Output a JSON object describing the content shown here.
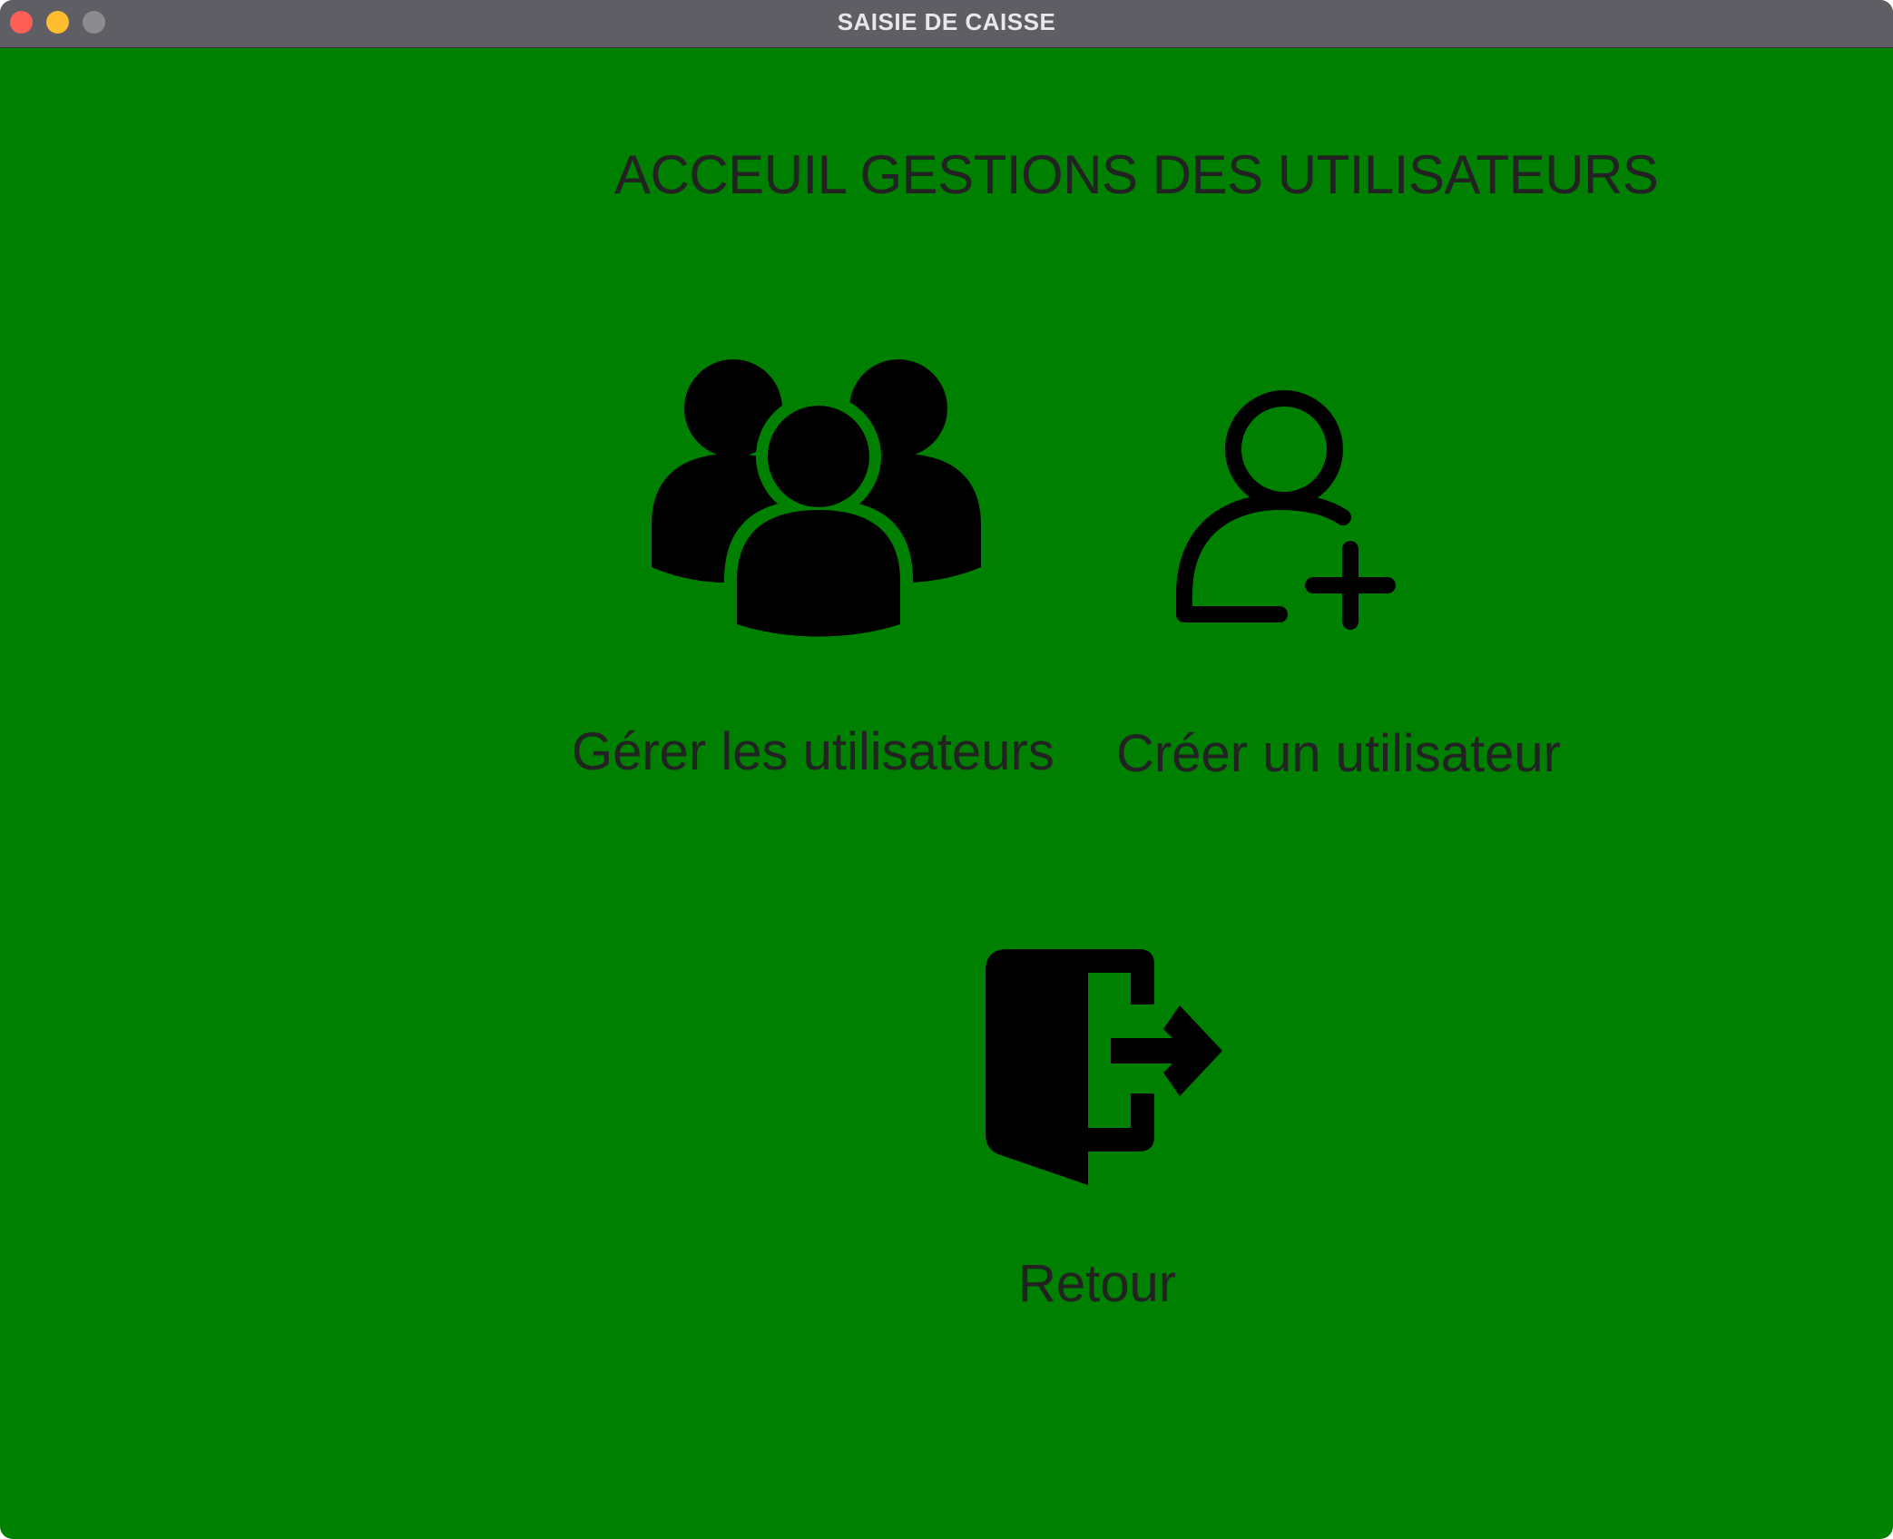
{
  "window": {
    "title": "SAISIE DE CAISSE"
  },
  "main": {
    "heading": "ACCEUIL GESTIONS DES UTILISATEURS",
    "actions": [
      {
        "label": "Gérer les utilisateurs",
        "icon": "users-group-icon"
      },
      {
        "label": "Créer un utilisateur",
        "icon": "user-add-icon"
      },
      {
        "label": "Retour",
        "icon": "exit-door-icon"
      }
    ]
  },
  "colors": {
    "background": "#008000",
    "icon": "#000000",
    "text": "#222222"
  }
}
